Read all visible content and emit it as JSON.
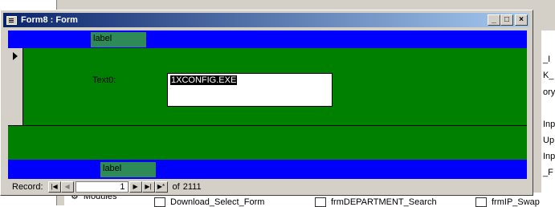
{
  "window": {
    "title": "Form8 : Form",
    "buttons": {
      "minimize": "_",
      "maximize": "□",
      "close": "×"
    }
  },
  "form": {
    "header_label": "label",
    "field_label": "Text0:",
    "field_value": "1XCONFIG.EXE",
    "footer_label": "label"
  },
  "navigation": {
    "record_label": "Record:",
    "current_record": "1",
    "of_label": "of",
    "total_records": "2111"
  },
  "background": {
    "right_items": [
      "_I",
      "K_",
      "ory",
      "Inp",
      "Up",
      "Inp",
      "_F"
    ],
    "modules_label": "Modules",
    "bottom_items": [
      "Download_Select_Form",
      "frmDEPARTMENT_Search",
      "frmIP_Swap"
    ]
  },
  "colors": {
    "band_blue": "#0000ff",
    "detail_green": "#008000",
    "label_green": "#2e8b57"
  }
}
